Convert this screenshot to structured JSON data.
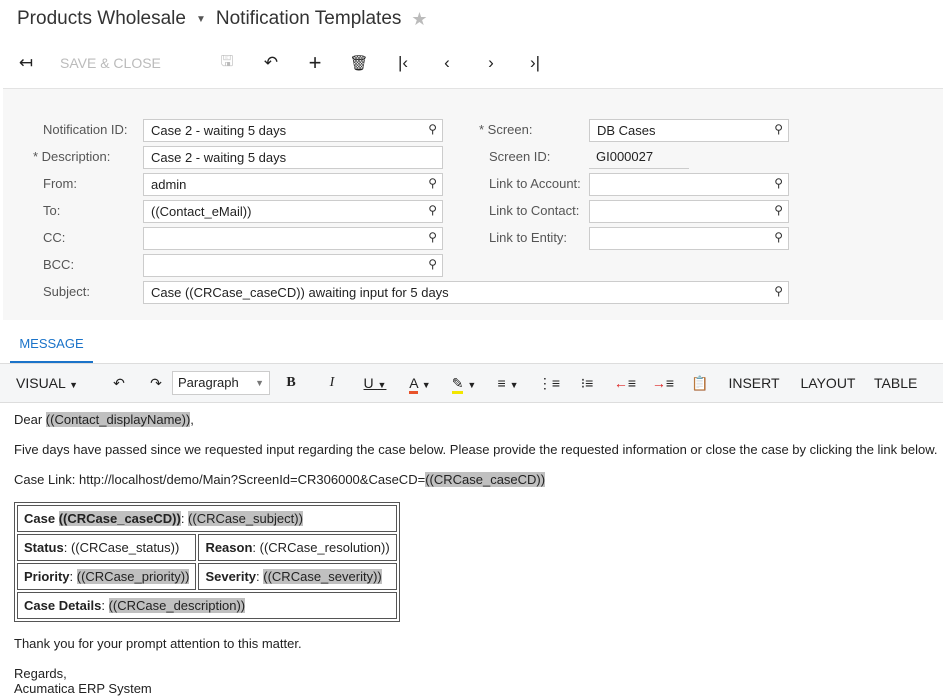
{
  "header": {
    "company": "Products Wholesale",
    "page": "Notification Templates"
  },
  "toolbar": {
    "save_close": "SAVE & CLOSE"
  },
  "form": {
    "notification_id": {
      "label": "Notification ID:",
      "value": "Case 2 - waiting 5 days"
    },
    "description": {
      "label": "Description:",
      "value": "Case 2 - waiting 5 days"
    },
    "from": {
      "label": "From:",
      "value": "admin"
    },
    "to": {
      "label": "To:",
      "value": "((Contact_eMail))"
    },
    "cc": {
      "label": "CC:",
      "value": ""
    },
    "bcc": {
      "label": "BCC:",
      "value": ""
    },
    "subject": {
      "label": "Subject:",
      "value": "Case ((CRCase_caseCD)) awaiting input for 5 days"
    },
    "screen": {
      "label": "Screen:",
      "value": "DB Cases"
    },
    "screen_id": {
      "label": "Screen ID:",
      "value": "GI000027"
    },
    "link_account": {
      "label": "Link to Account:",
      "value": ""
    },
    "link_contact": {
      "label": "Link to Contact:",
      "value": ""
    },
    "link_entity": {
      "label": "Link to Entity:",
      "value": ""
    }
  },
  "tabs": {
    "message": "MESSAGE"
  },
  "editor": {
    "mode": "VISUAL",
    "format": "Paragraph",
    "insert": "INSERT",
    "layout": "LAYOUT",
    "table": "TABLE",
    "font_color": "#e8532b",
    "highlight_color": "#f2e600"
  },
  "body": {
    "dear": "Dear ",
    "dear_field": "((Contact_displayName))",
    "dear_end": ",",
    "para1": "Five days have passed since we requested input regarding the case below. Please provide the requested information or close the case by clicking the link below.",
    "link_prefix": "Case Link: http://localhost/demo/Main?ScreenId=CR306000&CaseCD=",
    "link_field": "((CRCase_caseCD))",
    "t_case": "Case ",
    "t_case_field": "((CRCase_caseCD))",
    "t_colon": ": ",
    "t_subject_field": "((CRCase_subject))",
    "t_status": "Status",
    "t_status_field": "((CRCase_status))",
    "t_reason": "Reason",
    "t_reason_field": "((CRCase_resolution))",
    "t_priority": "Priority",
    "t_priority_field": "((CRCase_priority))",
    "t_severity": "Severity",
    "t_severity_field": "((CRCase_severity))",
    "t_details": "Case Details",
    "t_details_field": "((CRCase_description))",
    "thanks": "Thank you for your prompt attention to this matter.",
    "regards": "Regards,",
    "signature": "Acumatica ERP System"
  }
}
